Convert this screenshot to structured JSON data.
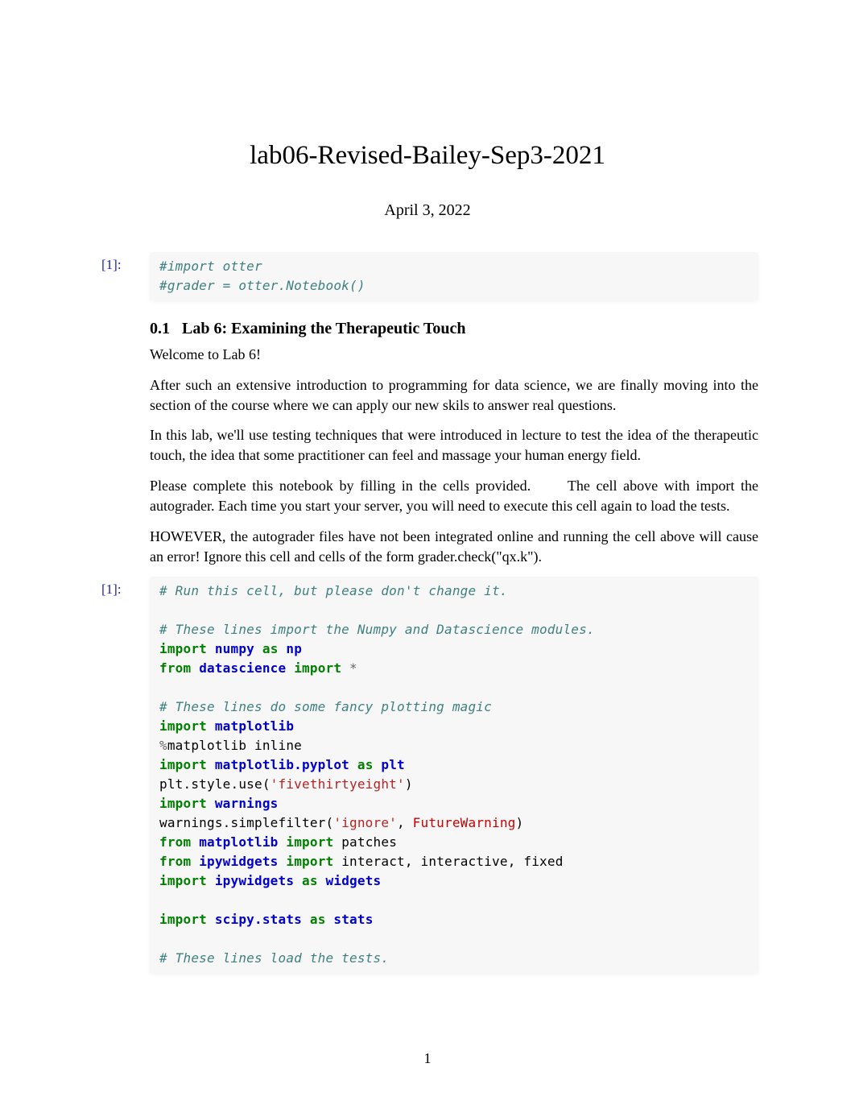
{
  "title": "lab06-Revised-Bailey-Sep3-2021",
  "date": "April 3, 2022",
  "page_num": "1",
  "cell1": {
    "prompt": "[1]:",
    "l1": "#import otter",
    "l2": "#grader = otter.Notebook()"
  },
  "section": {
    "heading_num": "0.1",
    "heading_text": "Lab 6: Examining the Therapeutic Touch",
    "p1": "Welcome to Lab 6!",
    "p2": "After such an extensive introduction to programming for data science, we are finally moving into the section of the course where we can apply our new skils to answer real questions.",
    "p3": "In this lab, we'll use testing techniques that were introduced in lecture to test the idea of the therapeutic touch, the idea that some practitioner can feel and massage your human energy field.",
    "p4a": "Please complete this notebook by filling in the cells provided.",
    "p4b": "The cell above with import the autograder. Each time you start your server, you will need to execute this cell again to load the tests.",
    "p5": "HOWEVER, the autograder files have not been integrated online and running the cell above will cause an error! Ignore this cell and cells of the form grader.check(\"qx.k\")."
  },
  "cell2": {
    "prompt": "[1]:",
    "l1": "# Run this cell, but please don't change it.",
    "l2": "",
    "l3": "# These lines import the Numpy and Datascience modules.",
    "kw_import": "import",
    "kw_as": "as",
    "kw_from": "from",
    "mod_numpy": "numpy",
    "alias_np": "np",
    "mod_datascience": "datascience",
    "star": "*",
    "l7": "# These lines do some fancy plotting magic",
    "mod_matplotlib": "matplotlib",
    "magic_pct": "%",
    "magic_name": "matplotlib",
    "magic_arg": "inline",
    "mod_pyplot": "matplotlib.pyplot",
    "alias_plt": "plt",
    "line_style": "plt.style.use(",
    "str_538": "'fivethirtyeight'",
    "close_paren": ")",
    "mod_warnings": "warnings",
    "line_warnfn": "warnings.simplefilter(",
    "str_ignore": "'ignore'",
    "comma": ", ",
    "err_future": "FutureWarning",
    "patches": "patches",
    "mod_ipyw": "ipywidgets",
    "interact_names": "interact, interactive, fixed",
    "alias_widgets": "widgets",
    "mod_scipy": "scipy.stats",
    "alias_stats": "stats",
    "l_last": "# These lines load the tests."
  }
}
